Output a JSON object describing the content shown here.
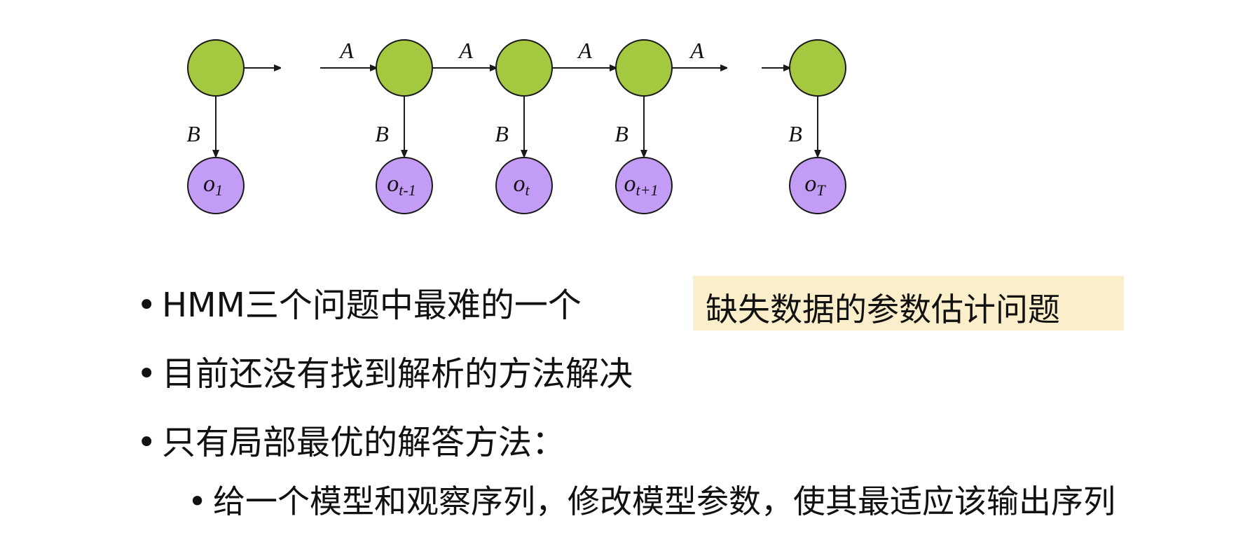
{
  "diagram": {
    "transition_label": "A",
    "emission_label": "B",
    "hidden_nodes": [
      {
        "id": "h1"
      },
      {
        "id": "h_t-1"
      },
      {
        "id": "h_t"
      },
      {
        "id": "h_t+1"
      },
      {
        "id": "h_T"
      }
    ],
    "observations": [
      {
        "base": "o",
        "sub": "1"
      },
      {
        "base": "o",
        "sub": "t-1"
      },
      {
        "base": "o",
        "sub": "t"
      },
      {
        "base": "o",
        "sub": "t+1"
      },
      {
        "base": "o",
        "sub": "T"
      }
    ],
    "colors": {
      "hidden": "#a4c941",
      "observed": "#c39cf5",
      "highlight": "#fbefcb"
    }
  },
  "bullets": [
    {
      "text": "HMM三个问题中最难的一个"
    },
    {
      "text": "目前还没有找到解析的方法解决"
    },
    {
      "text": "只有局部最优的解答方法："
    }
  ],
  "sub_bullets": [
    {
      "text": "给一个模型和观察序列，修改模型参数，使其最适应该输出序列"
    }
  ],
  "highlight_box": {
    "text": "缺失数据的参数估计问题"
  }
}
